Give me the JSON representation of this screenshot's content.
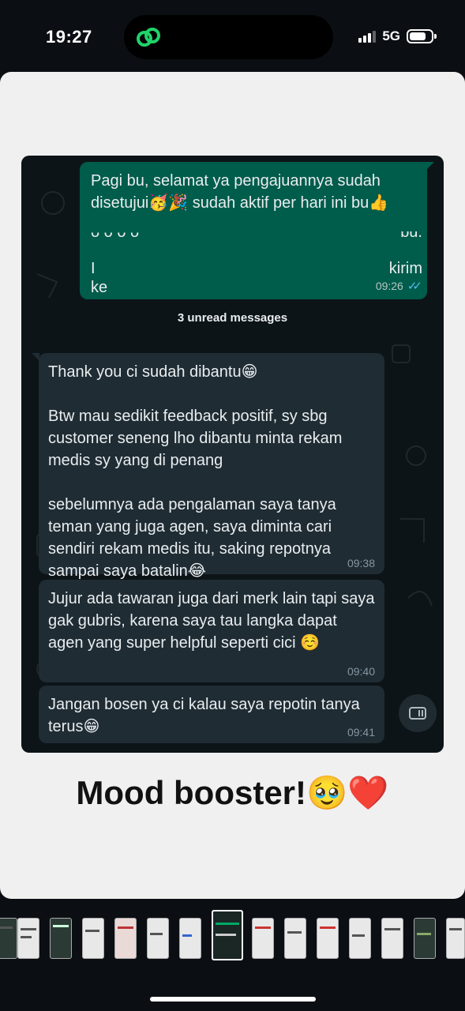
{
  "status_bar": {
    "time": "19:27",
    "network": "5G",
    "signal_level": 3,
    "battery_level": 0.75,
    "island_app_icon": "link-rings-icon"
  },
  "chat": {
    "outgoing": {
      "line1": "Pagi bu, selamat ya pengajuannya sudah",
      "line2": "disetujui🥳🎉 sudah aktif per hari ini bu👍",
      "redacted_1": "bu.",
      "redacted_2": "kirim",
      "redacted_3": "ke",
      "time": "09:26",
      "status_icon": "double-check-read-icon"
    },
    "unread_divider": "3 unread messages",
    "incoming": [
      {
        "text": "Thank you ci sudah dibantu😁\n\nBtw mau sedikit feedback positif, sy sbg customer seneng lho dibantu minta rekam medis sy yang di penang\n\nsebelumnya ada pengalaman saya tanya teman yang juga agen, saya diminta cari sendiri rekam medis itu, saking repotnya sampai saya batalin😂",
        "time": "09:38"
      },
      {
        "text": "Jujur ada tawaran juga dari merk lain tapi saya gak gubris, karena saya tau langka dapat agen yang super helpful seperti cici ☺️",
        "time": "09:40"
      },
      {
        "text": "Jangan bosen ya ci kalau saya repotin tanya terus😁",
        "time": "09:41"
      }
    ],
    "scroll_button_icon": "view-once-icon"
  },
  "caption": "Mood booster!🥹❤️",
  "colors": {
    "outgoing_bubble": "#005c4b",
    "incoming_bubble": "#1f2c34",
    "read_ticks": "#53bdeb",
    "card_bg": "#f0f0f0"
  }
}
